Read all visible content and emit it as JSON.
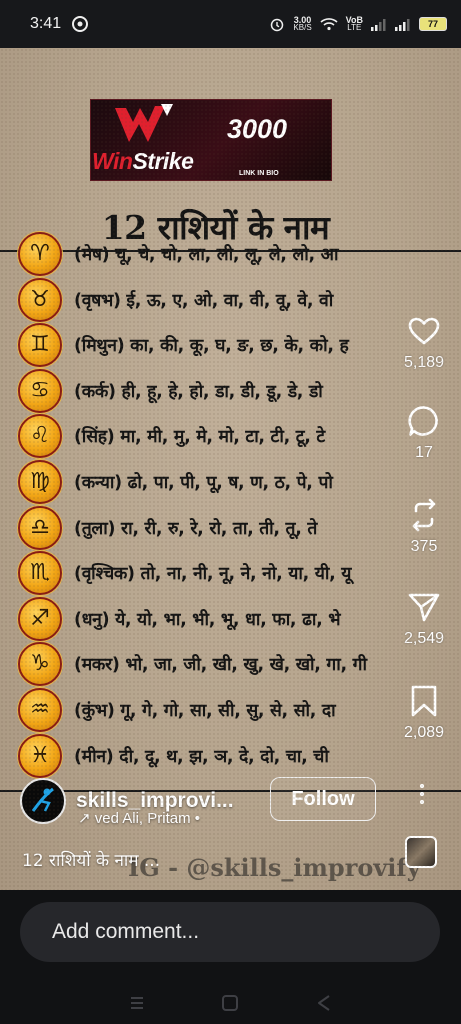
{
  "status_bar": {
    "time": "3:41",
    "net_speed_value": "3.00",
    "net_speed_unit": "KB/S",
    "volte_top": "VoB",
    "volte_bottom": "LTE",
    "battery": "77"
  },
  "post": {
    "banner": {
      "amount": "3000",
      "brand_win": "Win",
      "brand_strike": "Strike",
      "link": "LINK IN BIO"
    },
    "title": "12 राशियों के नाम",
    "rows": [
      {
        "glyph": "♈",
        "text": "(मेष) चू, चे, चो, ला, ली, लू, ले, लो, आ"
      },
      {
        "glyph": "♉",
        "text": "(वृषभ) ई, ऊ, ए, ओ, वा, वी, वू, वे, वो"
      },
      {
        "glyph": "♊",
        "text": "(मिथुन) का, की, कू, घ, ङ, छ, के, को, ह"
      },
      {
        "glyph": "♋",
        "text": "(कर्क) ही, हू, हे, हो, डा, डी, डू, डे, डो"
      },
      {
        "glyph": "♌",
        "text": "(सिंह) मा, मी, मु, मे, मो, टा, टी, टू, टे"
      },
      {
        "glyph": "♍",
        "text": "(कन्या) ढो, पा, पी, पू, ष, ण, ठ, पे, पो"
      },
      {
        "glyph": "♎",
        "text": "(तुला) रा, री, रु, रे, रो, ता, ती, तू, ते"
      },
      {
        "glyph": "♏",
        "text": "(वृश्चिक) तो, ना, नी, नू, ने, नो, या, यी, यू"
      },
      {
        "glyph": "♐",
        "text": "(धनु) ये, यो, भा, भी, भू, धा, फा, ढा, भे"
      },
      {
        "glyph": "♑",
        "text": "(मकर) भो, जा, जी, खी, खु, खे, खो, गा, गी"
      },
      {
        "glyph": "♒",
        "text": "(कुंभ) गू, गे, गो, सा, सी, सु, से, सो, दा"
      },
      {
        "glyph": "♓",
        "text": "(मीन) दी, दू, थ, झ, ञ, दे, दो, चा, ची"
      }
    ],
    "watermark": "IG - @skills_improvify"
  },
  "actions": {
    "like_icon": "heart-icon",
    "like_count": "5,189",
    "comment_icon": "comment-icon",
    "comment_count": "17",
    "repost_icon": "repost-icon",
    "repost_count": "375",
    "share_icon": "send-icon",
    "share_count": "2,549",
    "save_icon": "bookmark-icon",
    "save_count": "2,089"
  },
  "author": {
    "username": "skills_improvi...",
    "follow_label": "Follow",
    "audio": "↗ ved Ali, Pritam •",
    "caption": "12 राशियों के नाम ..."
  },
  "comment": {
    "placeholder": "Add comment..."
  },
  "colors": {
    "post_background": "#b6a58e",
    "badge_gold": "#f2a616",
    "banner_red": "#e0202e"
  }
}
